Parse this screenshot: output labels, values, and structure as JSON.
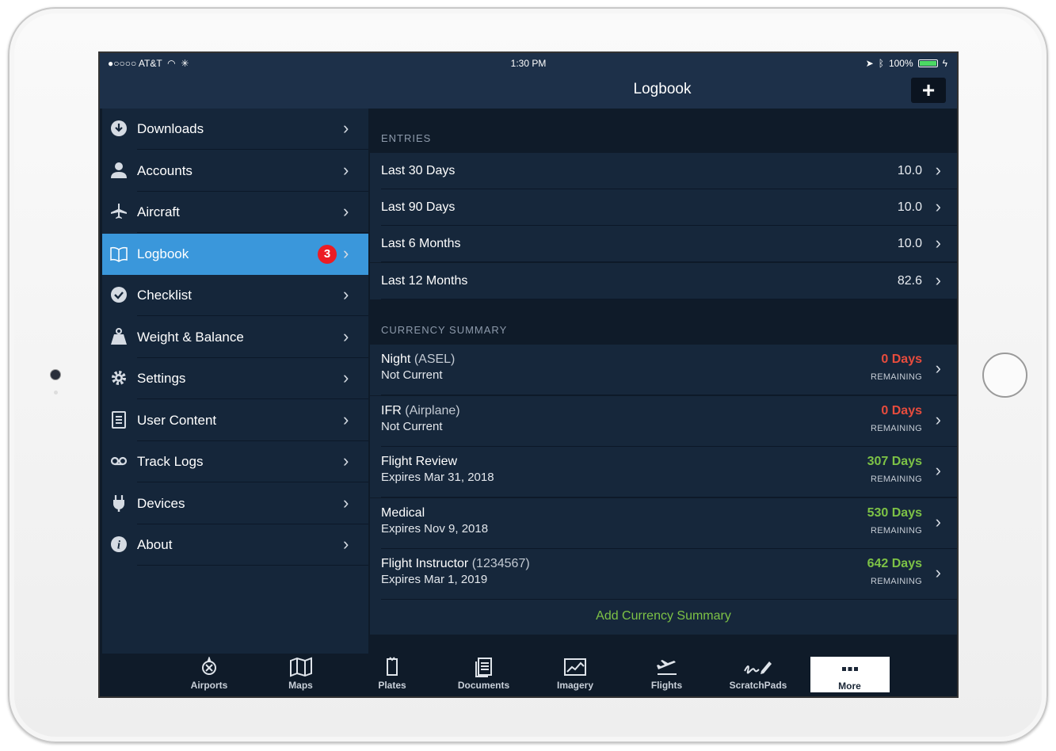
{
  "status": {
    "carrier": "●○○○○ AT&T",
    "time": "1:30 PM",
    "battery": "100%"
  },
  "nav": {
    "title": "Logbook",
    "add_label": "+"
  },
  "sidebar": {
    "items": [
      {
        "label": "Downloads",
        "icon": "download-icon"
      },
      {
        "label": "Accounts",
        "icon": "person-icon"
      },
      {
        "label": "Aircraft",
        "icon": "airplane-icon"
      },
      {
        "label": "Logbook",
        "icon": "book-icon",
        "badge": "3",
        "active": true
      },
      {
        "label": "Checklist",
        "icon": "check-circle-icon"
      },
      {
        "label": "Weight & Balance",
        "icon": "weight-icon"
      },
      {
        "label": "Settings",
        "icon": "gear-icon"
      },
      {
        "label": "User Content",
        "icon": "document-icon"
      },
      {
        "label": "Track Logs",
        "icon": "tracklog-icon"
      },
      {
        "label": "Devices",
        "icon": "plug-icon"
      },
      {
        "label": "About",
        "icon": "info-icon"
      }
    ]
  },
  "entries": {
    "header": "ENTRIES",
    "rows": [
      {
        "label": "Last 30 Days",
        "value": "10.0"
      },
      {
        "label": "Last 90 Days",
        "value": "10.0"
      },
      {
        "label": "Last 6 Months",
        "value": "10.0"
      },
      {
        "label": "Last 12 Months",
        "value": "82.6"
      }
    ]
  },
  "currency": {
    "header": "CURRENCY SUMMARY",
    "rows": [
      {
        "name": "Night",
        "paren": "(ASEL)",
        "sub": "Not Current",
        "days": "0 Days",
        "remaining": "REMAINING",
        "status": "red"
      },
      {
        "name": "IFR",
        "paren": "(Airplane)",
        "sub": "Not Current",
        "days": "0 Days",
        "remaining": "REMAINING",
        "status": "red"
      },
      {
        "name": "Flight Review",
        "paren": "",
        "sub": "Expires Mar 31, 2018",
        "days": "307 Days",
        "remaining": "REMAINING",
        "status": "green"
      },
      {
        "name": "Medical",
        "paren": "",
        "sub": "Expires Nov 9, 2018",
        "days": "530 Days",
        "remaining": "REMAINING",
        "status": "green"
      },
      {
        "name": "Flight Instructor",
        "paren": "(1234567)",
        "sub": "Expires Mar 1, 2019",
        "days": "642 Days",
        "remaining": "REMAINING",
        "status": "green"
      }
    ],
    "add_label": "Add Currency Summary"
  },
  "tabs": [
    {
      "label": "Airports",
      "icon": "airport-icon"
    },
    {
      "label": "Maps",
      "icon": "map-icon"
    },
    {
      "label": "Plates",
      "icon": "plates-icon"
    },
    {
      "label": "Documents",
      "icon": "documents-icon"
    },
    {
      "label": "Imagery",
      "icon": "imagery-icon"
    },
    {
      "label": "Flights",
      "icon": "flights-icon"
    },
    {
      "label": "ScratchPads",
      "icon": "scratchpad-icon"
    },
    {
      "label": "More",
      "icon": "more-icon",
      "active": true
    }
  ],
  "colors": {
    "accent": "#3a97db",
    "warning": "#e84c3d",
    "ok": "#7dc246",
    "badge": "#ec1c24"
  }
}
